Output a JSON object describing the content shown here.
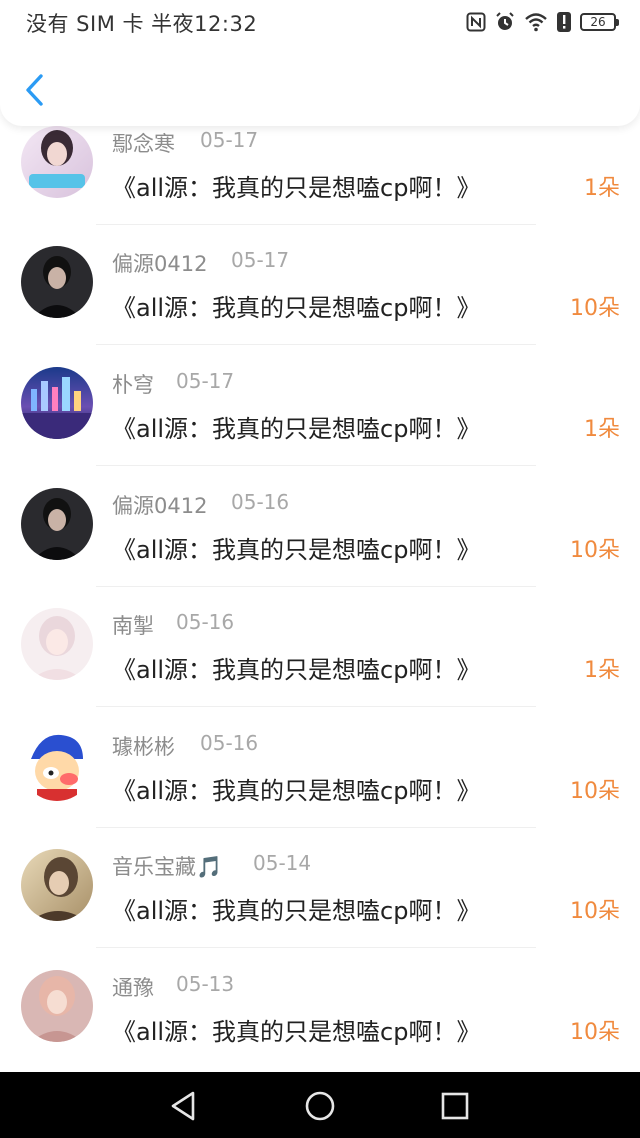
{
  "status_bar": {
    "text": "没有 SIM 卡 半夜12:32",
    "battery": "26",
    "icons": [
      "nfc-icon",
      "alarm-icon",
      "wifi-icon",
      "alert-icon",
      "battery-icon"
    ]
  },
  "header": {
    "back_icon": "chevron-left-icon",
    "accent_color": "#2b9bf4"
  },
  "gift_records": [
    {
      "name": "鄢念寒",
      "date": "05-17",
      "title": "《all源：我真的只是想嗑cp啊！》",
      "amount": "1朵"
    },
    {
      "name": "偏源0412",
      "date": "05-17",
      "title": "《all源：我真的只是想嗑cp啊！》",
      "amount": "10朵"
    },
    {
      "name": "朴穹",
      "date": "05-17",
      "title": "《all源：我真的只是想嗑cp啊！》",
      "amount": "1朵"
    },
    {
      "name": "偏源0412",
      "date": "05-16",
      "title": "《all源：我真的只是想嗑cp啊！》",
      "amount": "10朵"
    },
    {
      "name": "南掣",
      "date": "05-16",
      "title": "《all源：我真的只是想嗑cp啊！》",
      "amount": "1朵"
    },
    {
      "name": "璩彬彬",
      "date": "05-16",
      "title": "《all源：我真的只是想嗑cp啊！》",
      "amount": "10朵"
    },
    {
      "name": "音乐宝藏🎵",
      "date": "05-14",
      "title": "《all源：我真的只是想嗑cp啊！》",
      "amount": "10朵"
    },
    {
      "name": "通豫",
      "date": "05-13",
      "title": "《all源：我真的只是想嗑cp啊！》",
      "amount": "10朵"
    }
  ],
  "colors": {
    "amount": "#f08a3e",
    "name": "#8c8c8c",
    "date": "#a8a8a8",
    "title": "#222222"
  },
  "nav_bar": {
    "buttons": [
      "back-triangle-icon",
      "home-circle-icon",
      "recents-square-icon"
    ]
  }
}
